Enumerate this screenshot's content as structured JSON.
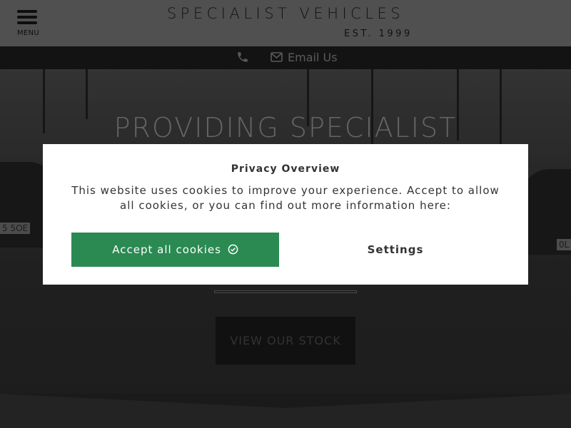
{
  "header": {
    "menu_label": "MENU",
    "logo_title": "SPECIALIST VEHICLES",
    "logo_est": "EST. 1999"
  },
  "contact": {
    "phone_icon": "phone-icon",
    "email_icon": "envelope-icon",
    "email_label": "Email Us"
  },
  "hero": {
    "title": "PROVIDING SPECIALIST",
    "stock_button": "VIEW OUR STOCK",
    "plate_left": "5 5OE",
    "plate_right": "0L"
  },
  "cookie_modal": {
    "title": "Privacy Overview",
    "text": "This website uses cookies to improve your experience. Accept to allow all cookies, or you can find out more information here:",
    "accept_label": "Accept all cookies",
    "settings_label": "Settings",
    "accent_color": "#2a8a52"
  }
}
